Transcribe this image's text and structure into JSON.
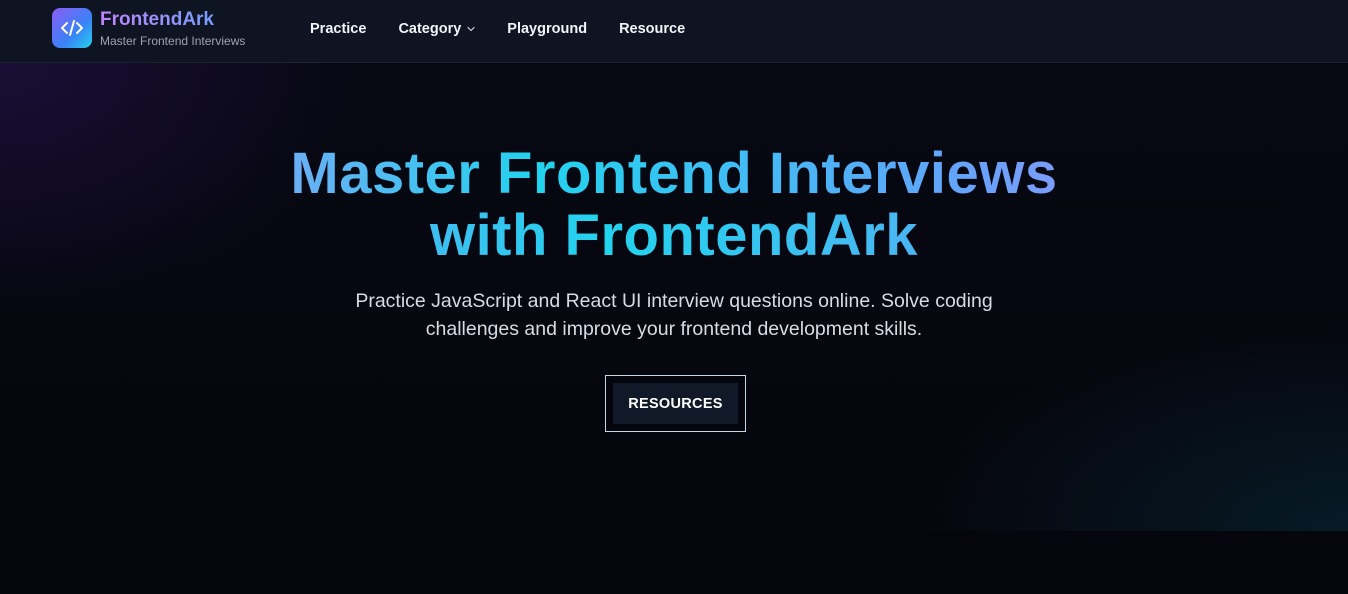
{
  "brand": {
    "name": "FrontendArk",
    "tagline": "Master Frontend Interviews",
    "logo_icon": "code-brackets-icon"
  },
  "nav": {
    "items": [
      {
        "label": "Practice"
      },
      {
        "label": "Category",
        "has_dropdown": true
      },
      {
        "label": "Playground"
      },
      {
        "label": "Resource"
      }
    ]
  },
  "hero": {
    "title_line1": "Master Frontend Interviews",
    "title_line2": "with FrontendArk",
    "subtitle": "Practice JavaScript and React UI interview questions online. Solve coding challenges and improve your frontend development skills.",
    "cta_label": "RESOURCES"
  },
  "colors": {
    "background": "#05060d",
    "topbar": "#0f1422",
    "accent_purple": "#c084fc",
    "accent_cyan": "#22d3ee",
    "accent_blue": "#60a5fa"
  }
}
